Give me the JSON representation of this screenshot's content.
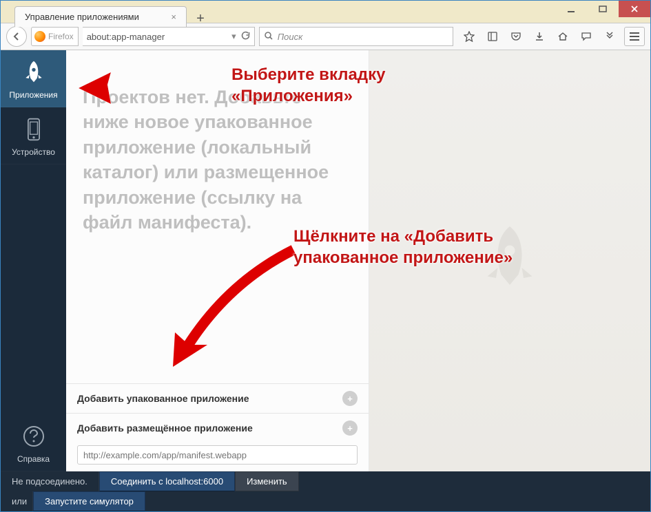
{
  "window": {
    "tab_title": "Управление приложениями"
  },
  "toolbar": {
    "identity_label": "Firefox",
    "url": "about:app-manager",
    "search_placeholder": "Поиск"
  },
  "sidebar": {
    "apps": "Приложения",
    "device": "Устройство",
    "help": "Справка"
  },
  "panel": {
    "placeholder": "Проектов нет. Добавьте ниже новое упакованное приложение (локальный каталог) или размещенное приложение (ссылку на файл манифеста).",
    "add_packaged": "Добавить упакованное приложение",
    "add_hosted": "Добавить размещённое приложение",
    "manifest_placeholder": "http://example.com/app/manifest.webapp"
  },
  "bottombar": {
    "not_connected": "Не подсоединено.",
    "connect": "Соединить с localhost:6000",
    "change": "Изменить",
    "or": "или",
    "start_sim": "Запустите симулятор"
  },
  "annotations": {
    "a1_l1": "Выберите вкладку",
    "a1_l2": "«Приложения»",
    "a2_l1": "Щёлкните на «Добавить",
    "a2_l2": "упакованное приложение»"
  }
}
